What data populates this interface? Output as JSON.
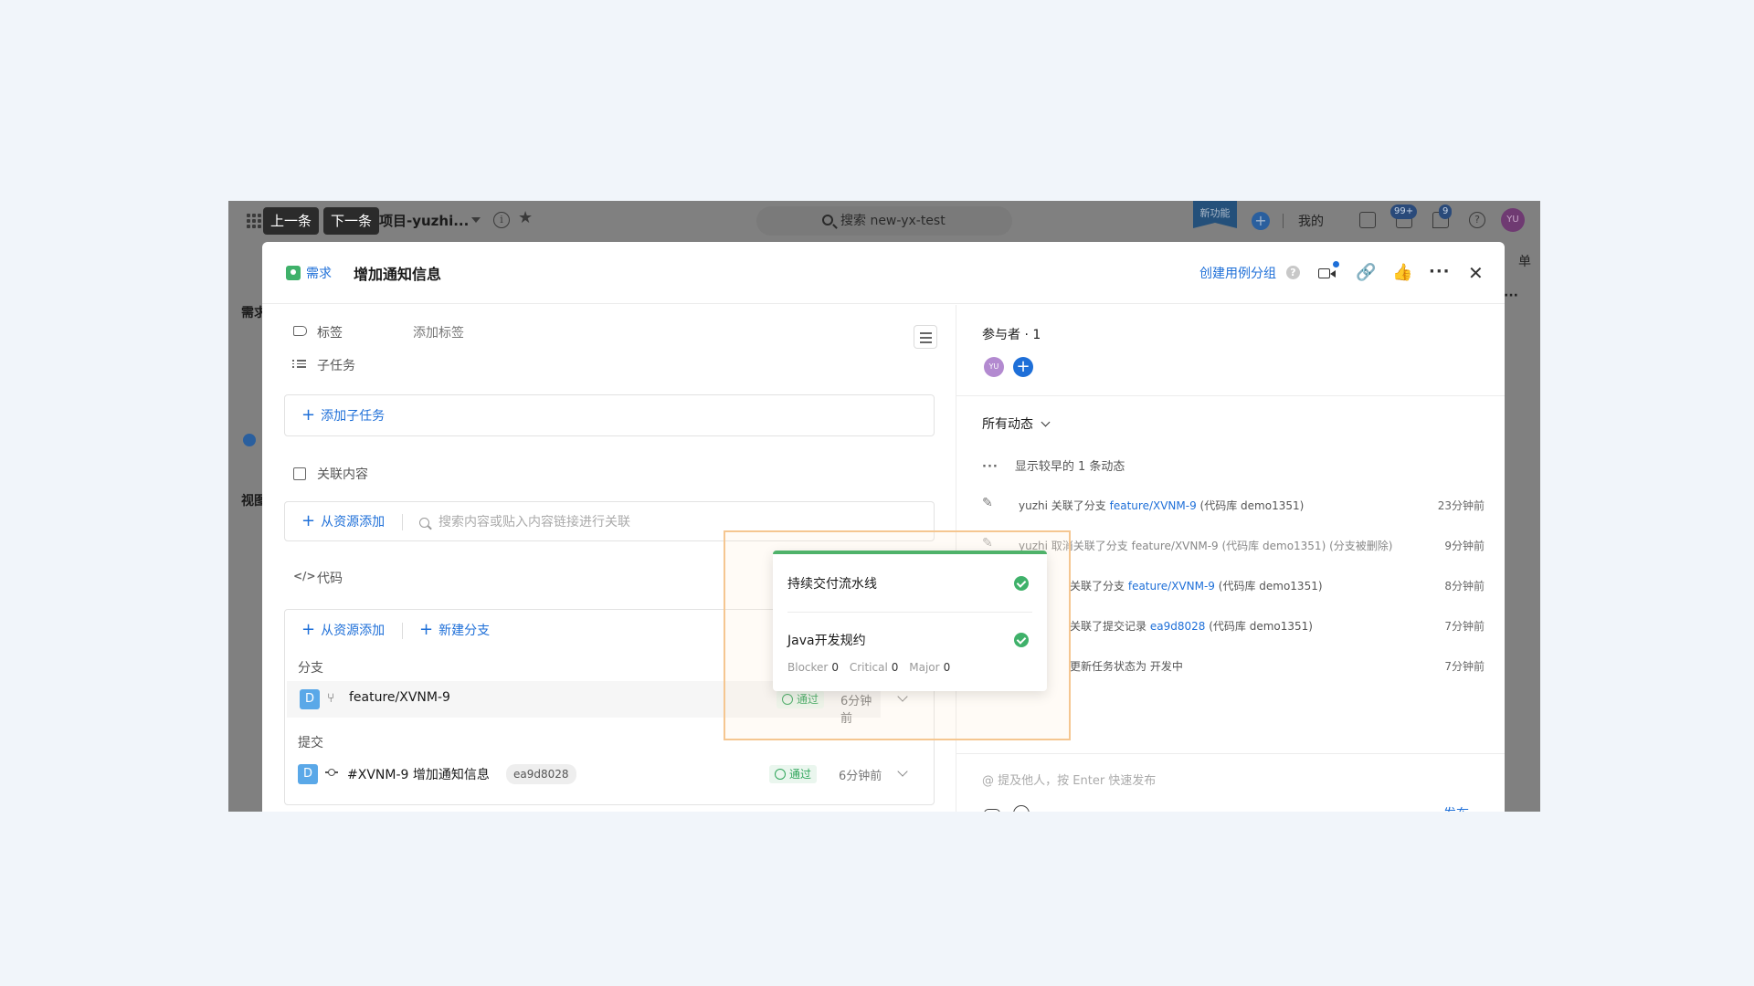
{
  "topbar": {
    "prev_label": "上一条",
    "next_label": "下一条",
    "project_title": "项目-yuzhi...",
    "search_placeholder": "搜索 new-yx-test",
    "new_feature_label": "新功能",
    "mine_label": "我的",
    "notification_count": "99+",
    "message_count": "9",
    "user_initials": "YU"
  },
  "background": {
    "sidebar_heading": "需求",
    "sidebar_view": "视图",
    "right_edge_text": "单"
  },
  "modal": {
    "type_label": "需求",
    "title": "增加通知信息",
    "create_group_link": "创建用例分组"
  },
  "left": {
    "tag_label": "标签",
    "tag_add": "添加标签",
    "subtask_label": "子任务",
    "add_subtask": "添加子任务",
    "related_label": "关联内容",
    "add_from_resource": "从资源添加",
    "search_related_placeholder": "搜索内容或贴入内容链接进行关联",
    "code_label": "代码",
    "new_branch": "新建分支",
    "branch_heading": "分支",
    "commit_heading": "提交",
    "branch": {
      "badge": "D",
      "name": "feature/XVNM-9",
      "status": "通过",
      "time": "6分钟前"
    },
    "commit": {
      "badge": "D",
      "name": "#XVNM-9 增加通知信息",
      "hash": "ea9d8028",
      "status": "通过",
      "time": "6分钟前"
    }
  },
  "popover": {
    "items": [
      {
        "title": "持续交付流水线"
      },
      {
        "title": "Java开发规约"
      }
    ],
    "stats": [
      {
        "label": "Blocker",
        "value": "0"
      },
      {
        "label": "Critical",
        "value": "0"
      },
      {
        "label": "Major",
        "value": "0"
      }
    ]
  },
  "right": {
    "participants": "参与者 · 1",
    "participant_initials": "YU",
    "all_activity": "所有动态",
    "show_earlier": "显示较早的 1 条动态",
    "activities": [
      {
        "user": "yuzhi",
        "action": "关联了分支",
        "link": "feature/XVNM-9",
        "rest": "(代码库 demo1351)",
        "time": "23分钟前"
      },
      {
        "user": "yuzhi",
        "action": "取消关联了分支 feature/XVNM-9 (代码库 demo1351) (分支被删除)",
        "link": "",
        "rest": "",
        "time": "9分钟前"
      },
      {
        "user": "",
        "action": "关联了分支",
        "link": "feature/XVNM-9",
        "rest": "(代码库 demo1351)",
        "time": "8分钟前"
      },
      {
        "user": "",
        "action": "关联了提交记录",
        "link": "ea9d8028",
        "rest": "(代码库 demo1351)",
        "time": "7分钟前"
      },
      {
        "user": "",
        "action": "更新任务状态为 开发中",
        "link": "",
        "rest": "",
        "time": "7分钟前"
      }
    ],
    "comment_placeholder": "@ 提及他人，按 Enter 快速发布",
    "publish_label": "发布"
  },
  "colors": {
    "accent": "#1e6fd8",
    "success": "#3fb16a",
    "highlight": "#f5c690"
  }
}
